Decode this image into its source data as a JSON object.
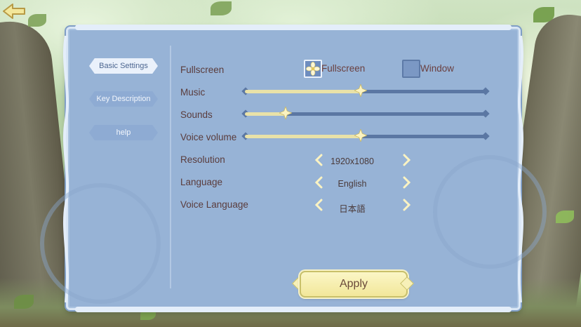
{
  "nav": {
    "items": [
      {
        "label": "Basic Settings",
        "active": true
      },
      {
        "label": "Key Description",
        "active": false
      },
      {
        "label": "help",
        "active": false
      }
    ]
  },
  "settings": {
    "fullscreen": {
      "label": "Fullscreen",
      "options": [
        {
          "label": "Fullscreen",
          "selected": true
        },
        {
          "label": "Window",
          "selected": false
        }
      ]
    },
    "music": {
      "label": "Music",
      "level": 0.48
    },
    "sounds": {
      "label": "Sounds",
      "level": 0.17
    },
    "voice_volume": {
      "label": "Voice volume",
      "level": 0.48
    },
    "resolution": {
      "label": "Resolution",
      "value": "1920x1080"
    },
    "language": {
      "label": "Language",
      "value": "English"
    },
    "voice_language": {
      "label": "Voice Language",
      "value": "日本語"
    }
  },
  "apply_label": "Apply",
  "icons": {
    "back": "back-arrow-icon",
    "flower": "flower-icon",
    "star": "star-icon",
    "arrow_left": "chevron-left-icon",
    "arrow_right": "chevron-right-icon"
  },
  "colors": {
    "panel": "#97b3d6",
    "accent": "#f2e79a",
    "text": "#5a3c3c"
  }
}
